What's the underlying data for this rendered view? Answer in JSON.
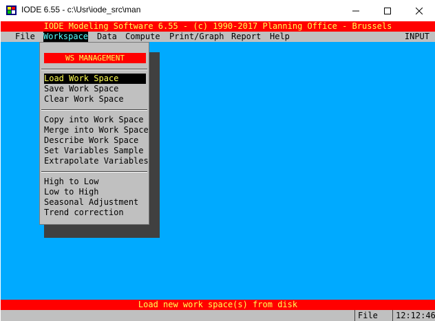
{
  "window": {
    "title": "IODE 6.55 - c:\\Usr\\iode_src\\man",
    "controls": {
      "minimize": "─",
      "maximize": "☐",
      "close": "✕"
    }
  },
  "banner": "IODE Modeling Software 6.55 - (c) 1990-2017 Planning Office - Brussels",
  "menubar": {
    "items": [
      "File",
      "Workspace",
      "Data",
      "Compute",
      "Print/Graph",
      "Report",
      "Help"
    ],
    "mode": "INPUT"
  },
  "dropdown": {
    "header": "WS MANAGEMENT",
    "groups": [
      [
        "Load Work Space",
        "Save Work Space",
        "Clear Work Space"
      ],
      [
        "Copy into Work Space",
        "Merge into Work Space",
        "Describe Work Space",
        "Set Variables Sample",
        "Extrapolate Variables"
      ],
      [
        "High to Low",
        "Low to High",
        "Seasonal Adjustment",
        "Trend correction"
      ]
    ],
    "selected": "Load Work Space"
  },
  "status_message": "Load new work space(s) from disk",
  "statusbar": {
    "context": "File",
    "time": "12:12:46"
  },
  "colors": {
    "console_bg": "#00aaff",
    "banner_bg": "#ff0000",
    "banner_fg": "#ffff55",
    "menu_bg": "#c0c0c0"
  }
}
